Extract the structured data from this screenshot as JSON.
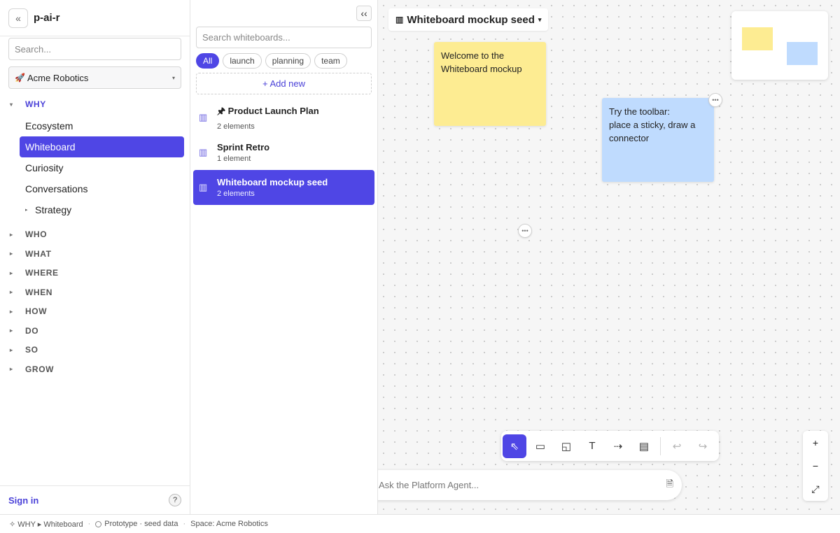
{
  "sidebar": {
    "collapse_glyph": "«",
    "app_title": "p-ai-r",
    "search_placeholder": "Search...",
    "org": {
      "name": "Acme Robotics",
      "icon": "rocket-icon",
      "caret": "▾"
    },
    "groups": [
      {
        "label": "WHY",
        "open": true,
        "items": [
          "Ecosystem",
          "Whiteboard",
          "Curiosity",
          "Conversations",
          "Strategy"
        ],
        "active_item": "Whiteboard"
      },
      {
        "label": "WHO"
      },
      {
        "label": "WHAT"
      },
      {
        "label": "WHERE"
      },
      {
        "label": "WHEN"
      },
      {
        "label": "HOW"
      },
      {
        "label": "DO"
      },
      {
        "label": "SO"
      },
      {
        "label": "GROW"
      }
    ],
    "sign_in": "Sign in",
    "help": "?"
  },
  "list_panel": {
    "collapse_glyph": "‹‹",
    "search_placeholder": "Search whiteboards...",
    "chips": [
      "All",
      "launch",
      "planning",
      "team"
    ],
    "active_chip": "All",
    "add_new": "+ Add new",
    "items": [
      {
        "title": "Product Launch Plan",
        "pin": "🖈",
        "count": "2 elements"
      },
      {
        "title": "Sprint Retro",
        "pin": "",
        "count": "1 element"
      },
      {
        "title": "Whiteboard mockup seed",
        "pin": "",
        "count": "2 elements",
        "active": true
      }
    ]
  },
  "canvas": {
    "title": "Whiteboard mockup seed",
    "title_caret": "▾",
    "stickies": [
      {
        "text": "Welcome to the\nWhiteboard mockup",
        "color": "#fdec92"
      },
      {
        "text": "Try the toolbar:\nplace a sticky, draw a\nconnector",
        "color": "#bfdbfe"
      }
    ],
    "toolbar": {
      "select": "⇖",
      "sticky": "▭",
      "shapes": "◱",
      "text": "T",
      "connector": "⇢",
      "comment": "▤",
      "undo": "↩",
      "redo": "↪"
    },
    "zoom": {
      "in": "+",
      "out": "−",
      "fit": "⤢"
    },
    "agent": {
      "placeholder": "Ask the Platform Agent...",
      "logo": "🦋",
      "attach": "🗎"
    }
  },
  "statusbar": {
    "breadcrumb": "✧ WHY ▸ Whiteboard",
    "mode": "Prototype · seed data",
    "space": "Space: Acme Robotics"
  },
  "colors": {
    "accent": "#4f46e5",
    "sticky_yellow": "#fdec92",
    "sticky_blue": "#bfdbfe"
  }
}
